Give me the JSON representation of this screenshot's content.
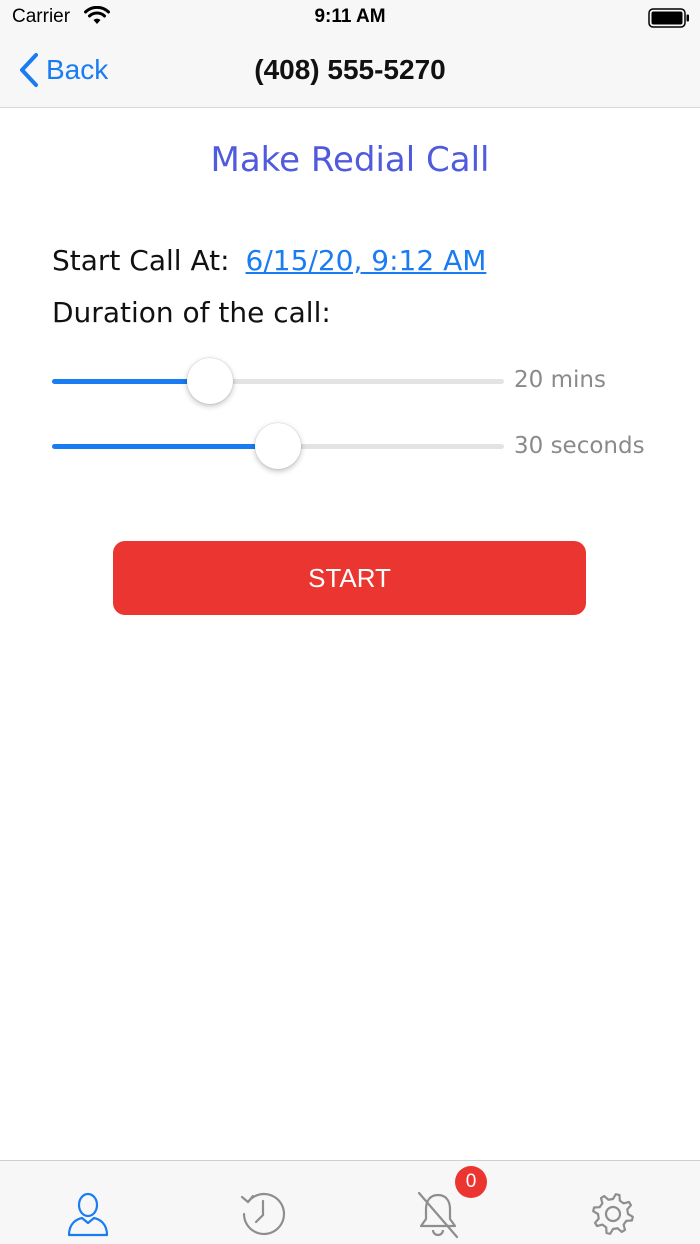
{
  "status_bar": {
    "carrier": "Carrier",
    "time": "9:11 AM"
  },
  "nav": {
    "back_label": "Back",
    "title": "(408) 555-5270"
  },
  "main": {
    "title": "Make Redial Call",
    "start_label": "Start Call At:",
    "start_value": "6/15/20, 9:12 AM",
    "duration_label": "Duration of the call:",
    "sliders": [
      {
        "value_label": "20 mins",
        "level": 0.35
      },
      {
        "value_label": "30 seconds",
        "level": 0.5
      }
    ],
    "start_button": "START"
  },
  "tab_bar": {
    "tabs": [
      {
        "icon": "person-icon",
        "active": true
      },
      {
        "icon": "history-clock-icon",
        "active": false
      },
      {
        "icon": "bell-off-icon",
        "active": false
      },
      {
        "icon": "gear-icon",
        "active": false
      }
    ],
    "badge_count": "0"
  },
  "colors": {
    "accent": "#1a7cf2",
    "title": "#4f5bdc",
    "danger": "#ea3530",
    "inactive_icon": "#8e8e8e"
  }
}
